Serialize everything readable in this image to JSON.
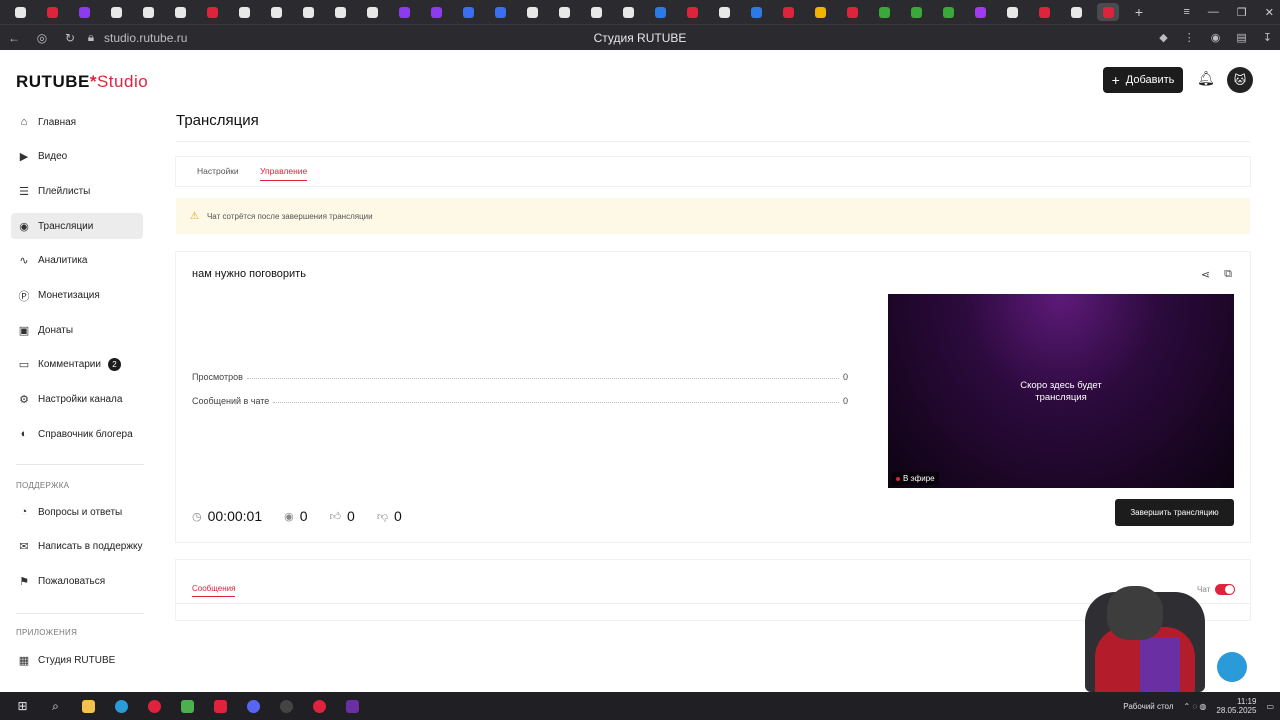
{
  "browser": {
    "url": "studio.rutube.ru",
    "window_title": "Студия RUTUBE",
    "tab_colors": [
      "#e8e8e8",
      "#e0233c",
      "#8b3cf0",
      "#e8e8e8",
      "#e8e8e8",
      "#e8e8e8",
      "#e0233c",
      "#e8e8e8",
      "#e8e8e8",
      "#e8e8e8",
      "#e8e8e8",
      "#e8e8e8",
      "#8b3cf0",
      "#8b3cf0",
      "#3c6ef0",
      "#3c6ef0",
      "#e8e8e8",
      "#e8e8e8",
      "#e8e8e8",
      "#e8e8e8",
      "#2c7be5",
      "#e0233c",
      "#e8e8e8",
      "#2c7be5",
      "#e0233c",
      "#f0b400",
      "#e0233c",
      "#3aa83a",
      "#3aa83a",
      "#3aa83a",
      "#a03cf0",
      "#e8e8e8",
      "#e0233c",
      "#e8e8e8",
      "#e0233c"
    ]
  },
  "header": {
    "logo_main": "RUTUBE",
    "logo_studio": "Studio",
    "add_button": "Добавить",
    "avatar_icon": "cat-avatar"
  },
  "sidebar": {
    "items": [
      {
        "label": "Главная",
        "icon": "home-icon"
      },
      {
        "label": "Видео",
        "icon": "video-icon"
      },
      {
        "label": "Плейлисты",
        "icon": "playlist-icon"
      },
      {
        "label": "Трансляции",
        "icon": "broadcast-icon",
        "active": true
      },
      {
        "label": "Аналитика",
        "icon": "analytics-icon"
      },
      {
        "label": "Монетизация",
        "icon": "money-icon"
      },
      {
        "label": "Донаты",
        "icon": "donate-icon"
      },
      {
        "label": "Комментарии",
        "icon": "comments-icon",
        "badge": "2"
      },
      {
        "label": "Настройки канала",
        "icon": "settings-icon"
      },
      {
        "label": "Справочник блогера",
        "icon": "handbook-icon"
      }
    ],
    "support_header": "ПОДДЕРЖКА",
    "support_items": [
      {
        "label": "Вопросы и ответы",
        "icon": "faq-icon"
      },
      {
        "label": "Написать в поддержку",
        "icon": "mail-icon"
      },
      {
        "label": "Пожаловаться",
        "icon": "flag-icon"
      }
    ],
    "apps_header": "ПРИЛОЖЕНИЯ",
    "apps_items": [
      {
        "label": "Студия RUTUBE",
        "icon": "app-icon"
      }
    ]
  },
  "main": {
    "title": "Трансляция",
    "tabs": [
      {
        "label": "Настройки"
      },
      {
        "label": "Управление",
        "active": true
      }
    ],
    "warning": "Чат сотрётся после завершения трансляции",
    "stream": {
      "name": "нам нужно поговорить",
      "stats": [
        {
          "label": "Просмотров",
          "value": "0"
        },
        {
          "label": "Сообщений в чате",
          "value": "0"
        }
      ],
      "preview_text_1": "Скоро здесь будет",
      "preview_text_2": "трансляция",
      "live_label": "В эфире",
      "duration": "00:00:01",
      "viewers": "0",
      "likes": "0",
      "dislikes": "0",
      "end_button": "Завершить трансляцию"
    },
    "messages": {
      "tab_label": "Сообщения",
      "chat_label": "Чат",
      "chat_enabled": true
    }
  },
  "taskbar": {
    "desktop_label": "Рабочий стол",
    "time": "11:19",
    "date": "28.05.2025"
  }
}
